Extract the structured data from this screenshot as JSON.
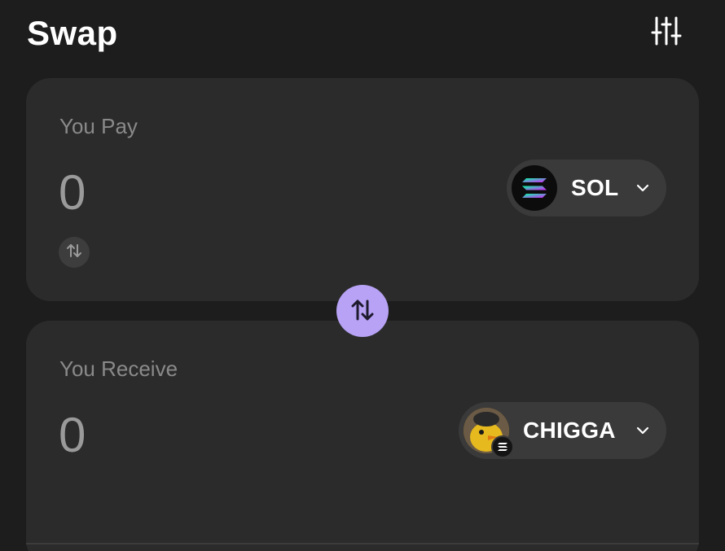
{
  "header": {
    "title": "Swap",
    "settings_icon": "sliders-icon"
  },
  "pay": {
    "label": "You Pay",
    "amount": "0",
    "token": {
      "symbol": "SOL",
      "icon": "solana-logo-icon"
    },
    "toggle_icon": "swap-arrows-icon"
  },
  "swap_direction": {
    "icon": "swap-arrows-icon",
    "color": "#b7a2f5"
  },
  "receive": {
    "label": "You Receive",
    "amount": "0",
    "token": {
      "symbol": "CHIGGA",
      "icon": "chigga-token-icon",
      "chain_badge": "solana-badge-icon"
    }
  },
  "colors": {
    "background": "#1d1d1d",
    "card": "#2b2b2b",
    "pill": "#3a3a3a",
    "accent": "#b7a2f5",
    "muted_text": "#8a8a8a"
  }
}
